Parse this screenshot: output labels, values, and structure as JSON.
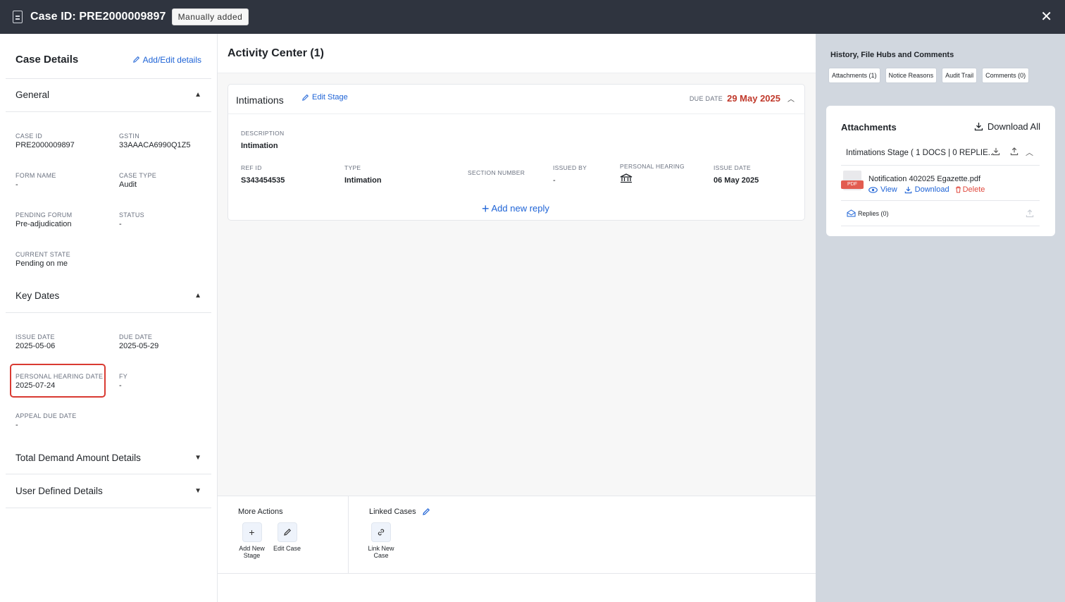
{
  "header": {
    "title": "Case ID: PRE2000009897",
    "badge": "Manually added",
    "close_icon": "close-icon"
  },
  "left": {
    "title": "Case Details",
    "add_edit_label": "Add/Edit details",
    "general": {
      "title": "General",
      "fields": {
        "case_id": {
          "label": "CASE ID",
          "value": "PRE2000009897"
        },
        "gstin": {
          "label": "GSTIN",
          "value": "33AAACA6990Q1Z5"
        },
        "form_name": {
          "label": "FORM NAME",
          "value": "-"
        },
        "case_type": {
          "label": "CASE TYPE",
          "value": "Audit"
        },
        "pending_forum": {
          "label": "PENDING FORUM",
          "value": "Pre-adjudication"
        },
        "status": {
          "label": "STATUS",
          "value": "-"
        },
        "current_state": {
          "label": "CURRENT STATE",
          "value": "Pending on me"
        }
      }
    },
    "key_dates": {
      "title": "Key Dates",
      "fields": {
        "issue_date": {
          "label": "ISSUE DATE",
          "value": "2025-05-06"
        },
        "due_date": {
          "label": "DUE DATE",
          "value": "2025-05-29"
        },
        "ph_date": {
          "label": "PERSONAL HEARING DATE",
          "value": "2025-07-24"
        },
        "fy": {
          "label": "FY",
          "value": "-"
        },
        "appeal_due": {
          "label": "APPEAL DUE DATE",
          "value": "-"
        }
      }
    },
    "total_demand": "Total Demand Amount Details",
    "user_defined": "User Defined Details"
  },
  "center": {
    "title": "Activity Center (1)",
    "card": {
      "title": "Intimations",
      "edit_stage": "Edit Stage",
      "due_label": "DUE DATE",
      "due_value": "29 May 2025",
      "description": {
        "label": "DESCRIPTION",
        "value": "Intimation"
      },
      "ref_id": {
        "label": "REF ID",
        "value": "S343454535"
      },
      "type": {
        "label": "TYPE",
        "value": "Intimation"
      },
      "section_number": {
        "label": "SECTION NUMBER",
        "value": ""
      },
      "issued_by": {
        "label": "ISSUED BY",
        "value": "-"
      },
      "personal_hearing": {
        "label": "PERSONAL HEARING",
        "icon": "bank-icon"
      },
      "issue_date": {
        "label": "ISSUE DATE",
        "value": "06 May 2025"
      },
      "add_reply": "Add new reply"
    },
    "more_actions": {
      "title": "More Actions",
      "add_stage": "Add New Stage",
      "edit_case": "Edit Case"
    },
    "linked_cases": {
      "title": "Linked Cases",
      "link_new": "Link New Case"
    }
  },
  "right": {
    "title": "History, File Hubs and Comments",
    "tabs": [
      "Attachments (1)",
      "Notice Reasons",
      "Audit Trail",
      "Comments (0)"
    ],
    "attachments": {
      "title": "Attachments",
      "download_all": "Download All",
      "stage": "Intimations Stage ( 1 DOCS | 0 REPLIE...",
      "file_name": "Notification 402025 Egazette.pdf",
      "file_tag": "PDF",
      "view": "View",
      "download": "Download",
      "delete": "Delete",
      "replies": "Replies (0)"
    }
  },
  "colors": {
    "topbar": "#2f343f",
    "link": "#1e63d6",
    "danger": "#c0392b",
    "highlight": "#d93a32",
    "right_bg": "#d1d7df"
  }
}
